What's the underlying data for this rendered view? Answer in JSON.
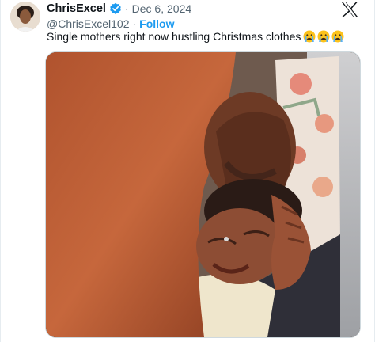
{
  "tweet": {
    "display_name": "ChrisExcel",
    "separator": "·",
    "date": "Dec 6, 2024",
    "handle": "@ChrisExcel102",
    "follow_separator": "·",
    "follow_label": "Follow",
    "text": "Single mothers right now hustling Christmas clothes",
    "emojis": [
      "crying-face-emoji",
      "crying-face-emoji",
      "crying-face-emoji"
    ]
  },
  "colors": {
    "link": "#1d9bf0",
    "verified": "#1d9bf0",
    "secondary_text": "#536471"
  },
  "icons": {
    "platform_logo": "x-logo-icon",
    "verified": "verified-badge-icon"
  }
}
